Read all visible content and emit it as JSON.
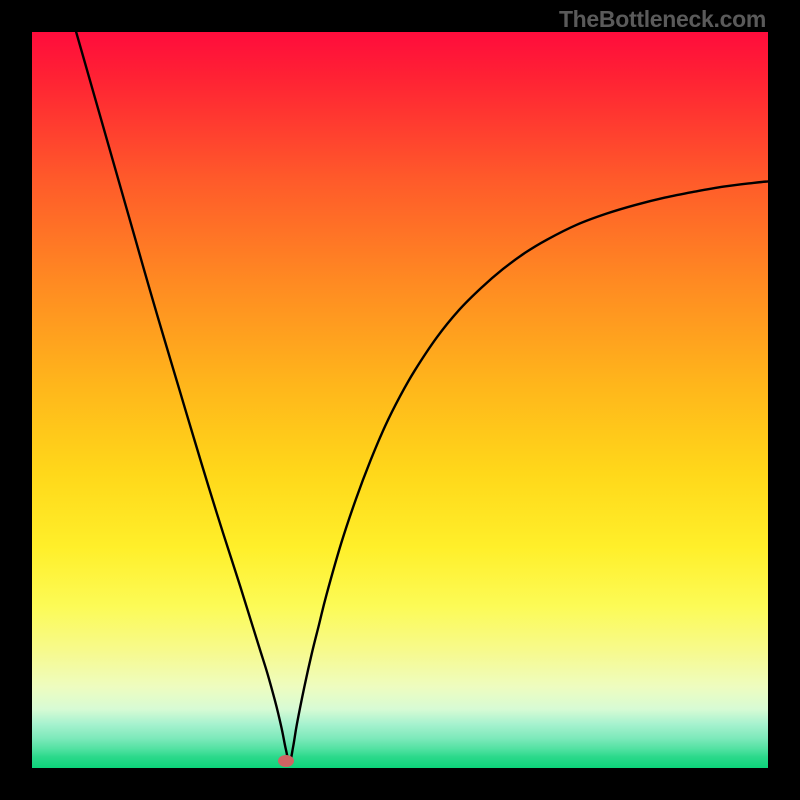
{
  "watermark": {
    "text": "TheBottleneck.com"
  },
  "marker": {
    "x_pct": 34.5,
    "y_pct": 99.0,
    "color": "#d06463"
  },
  "chart_data": {
    "type": "line",
    "title": "",
    "xlabel": "",
    "ylabel": "",
    "xlim": [
      0,
      100
    ],
    "ylim": [
      0,
      100
    ],
    "grid": false,
    "legend": false,
    "background_gradient": {
      "direction": "vertical",
      "stops": [
        {
          "pos": 0.0,
          "color": "#ff0c3c"
        },
        {
          "pos": 0.06,
          "color": "#ff2134"
        },
        {
          "pos": 0.2,
          "color": "#ff5a2a"
        },
        {
          "pos": 0.34,
          "color": "#ff8a22"
        },
        {
          "pos": 0.48,
          "color": "#ffb61b"
        },
        {
          "pos": 0.6,
          "color": "#ffd81a"
        },
        {
          "pos": 0.7,
          "color": "#ffef2a"
        },
        {
          "pos": 0.78,
          "color": "#fcfb56"
        },
        {
          "pos": 0.84,
          "color": "#f7fa8c"
        },
        {
          "pos": 0.89,
          "color": "#eefcc0"
        },
        {
          "pos": 0.92,
          "color": "#d7fbd4"
        },
        {
          "pos": 0.94,
          "color": "#a7f2cf"
        },
        {
          "pos": 0.96,
          "color": "#7ce9ba"
        },
        {
          "pos": 0.975,
          "color": "#4fe1a0"
        },
        {
          "pos": 0.985,
          "color": "#2bd98b"
        },
        {
          "pos": 1.0,
          "color": "#0cd47a"
        }
      ]
    },
    "series": [
      {
        "name": "bottleneck-curve",
        "color": "#000000",
        "x": [
          6.0,
          8.0,
          10.0,
          12.0,
          14.0,
          16.0,
          18.0,
          20.0,
          22.0,
          24.0,
          26.0,
          28.0,
          30.0,
          31.0,
          32.0,
          33.0,
          33.5,
          34.0,
          34.5,
          35.0,
          35.5,
          36.0,
          37.0,
          38.0,
          39.0,
          40.0,
          42.0,
          44.0,
          46.0,
          48.0,
          50.0,
          52.0,
          55.0,
          58.0,
          61.0,
          64.0,
          67.0,
          70.0,
          74.0,
          78.0,
          82.0,
          86.0,
          90.0,
          94.0,
          98.0,
          100.0
        ],
        "y": [
          100.0,
          93.0,
          86.0,
          79.0,
          72.0,
          65.0,
          58.2,
          51.5,
          44.8,
          38.2,
          31.8,
          25.6,
          19.2,
          16.0,
          12.8,
          9.2,
          7.2,
          5.0,
          2.5,
          0.8,
          3.0,
          6.0,
          11.0,
          15.5,
          19.5,
          23.5,
          30.5,
          36.5,
          41.8,
          46.5,
          50.5,
          54.0,
          58.5,
          62.2,
          65.2,
          67.8,
          70.0,
          71.8,
          73.8,
          75.3,
          76.5,
          77.5,
          78.3,
          79.0,
          79.5,
          79.7
        ]
      }
    ],
    "marker": {
      "x": 34.5,
      "y": 1.0,
      "color": "#d06463"
    }
  }
}
